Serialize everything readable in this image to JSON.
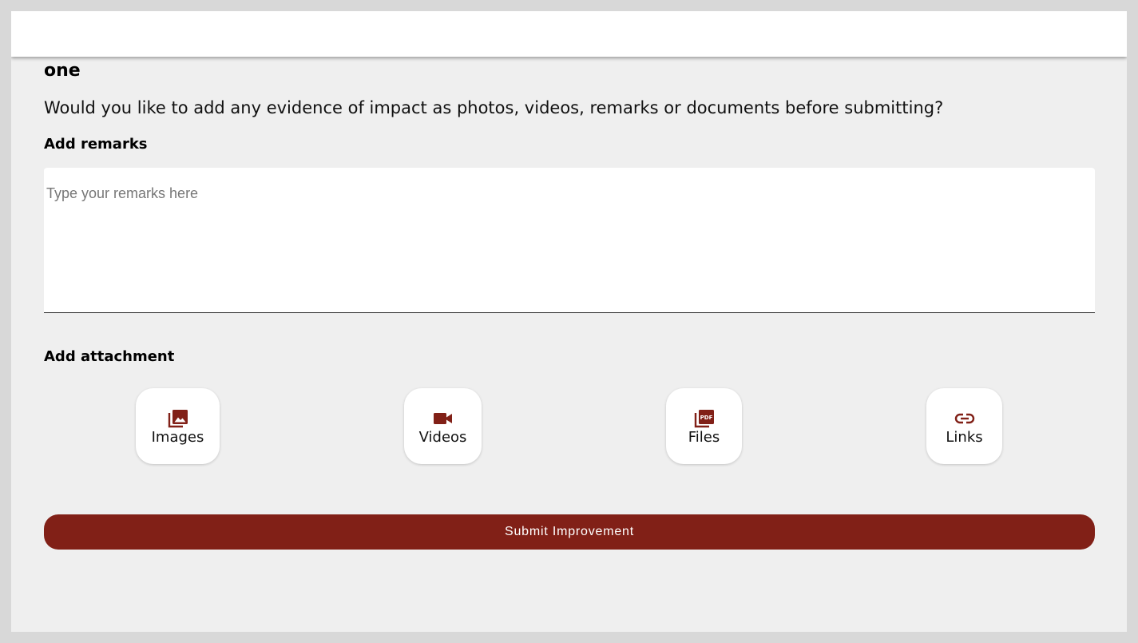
{
  "page": {
    "title": "one",
    "question": "Would you like to add any evidence of impact as photos, videos, remarks or documents before submitting?"
  },
  "remarks": {
    "label": "Add remarks",
    "placeholder": "Type your remarks here",
    "value": ""
  },
  "attachments": {
    "label": "Add attachment",
    "items": [
      {
        "label": "Images",
        "icon": "images-icon"
      },
      {
        "label": "Videos",
        "icon": "video-camera-icon"
      },
      {
        "label": "Files",
        "icon": "pdf-file-icon"
      },
      {
        "label": "Links",
        "icon": "link-icon"
      }
    ]
  },
  "submit": {
    "label": "Submit Improvement"
  },
  "colors": {
    "accent": "#812017",
    "background": "#efefef",
    "surface": "#ffffff"
  }
}
